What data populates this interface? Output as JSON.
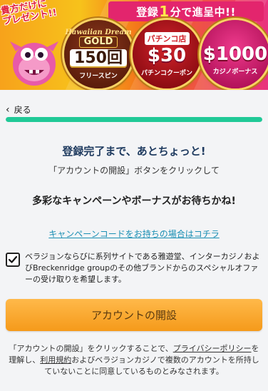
{
  "banner": {
    "present_tag": [
      "貴方だけに",
      "プレゼント!!"
    ],
    "register_ribbon": {
      "prefix": "登録",
      "num": "1",
      "suffix": "分で進呈中!!"
    },
    "medals": [
      {
        "logo_top": "Hawaiian Dream",
        "logo_gold": "GOLD",
        "value": "150回",
        "sub": "フリースピン"
      },
      {
        "badge": "パチンコ店",
        "value": "$30",
        "sub": "パチンコクーポン"
      },
      {
        "badge": "",
        "value": "$1000",
        "sub": "カジノボーナス"
      }
    ],
    "colors": {
      "ribbon": "#e3256d",
      "accent_yellow": "#ffe94a"
    }
  },
  "nav": {
    "back_label": "戻る"
  },
  "progress": {
    "value": 1.0,
    "color": "#20c997"
  },
  "main": {
    "title": "登録完了まで、あとちょっと!",
    "instruction": "「アカウントの開設」ボタンをクリックして",
    "promo": "多彩なキャンペーンやボーナスがお待ちかね!",
    "code_link": "キャンペーンコードをお持ちの場合はコチラ"
  },
  "consent": {
    "checked": true,
    "text": "ベラジョンならびに系列サイトである雅遊堂、インターカジノおよびBreckenridge groupのその他ブランドからのスペシャルオファーの受け取りを希望します。"
  },
  "cta": {
    "label": "アカウントの開設",
    "color": "#f59a1a"
  },
  "footer": {
    "part1": "「アカウントの開設」をクリックすることで、",
    "privacy_link": "プライバシーポリシー",
    "part2": "を理解し、",
    "terms_link": "利用規約",
    "part3": "およびベラジョンカジノで複数のアカウントを所持していないことに同意しているものとみなされます。"
  }
}
